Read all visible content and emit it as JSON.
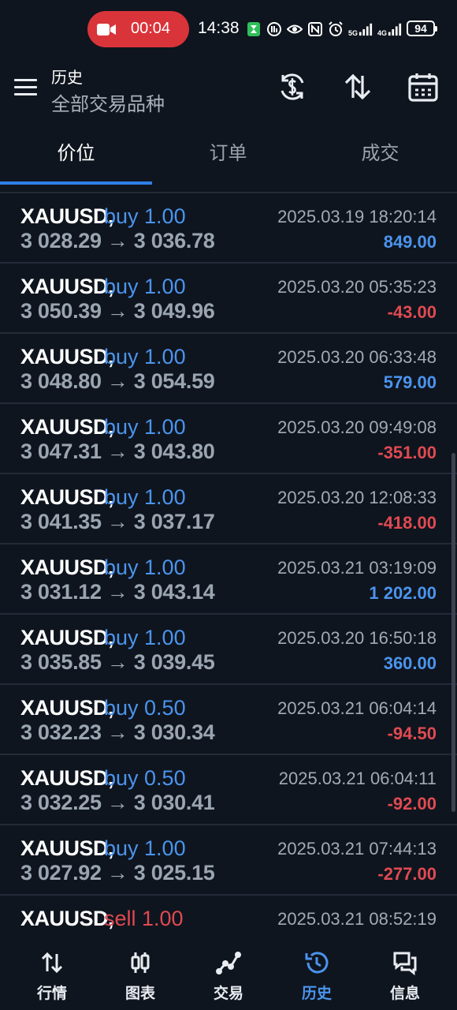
{
  "status_bar": {
    "recording_time": "00:04",
    "clock": "14:38",
    "net_5g": "5G",
    "net_4g": "4G",
    "battery": "94"
  },
  "header": {
    "title": "历史",
    "subtitle": "全部交易品种"
  },
  "tabs": [
    {
      "label": "价位",
      "active": true
    },
    {
      "label": "订单",
      "active": false
    },
    {
      "label": "成交",
      "active": false
    }
  ],
  "deals": [
    {
      "symbol": "XAUUSD,",
      "side": "buy 1.00",
      "type": "buy",
      "prices": "3 028.29 → 3 036.78",
      "time": "2025.03.19 18:20:14",
      "profit": "849.00",
      "sign": "pos"
    },
    {
      "symbol": "XAUUSD,",
      "side": "buy 1.00",
      "type": "buy",
      "prices": "3 050.39 → 3 049.96",
      "time": "2025.03.20 05:35:23",
      "profit": "-43.00",
      "sign": "neg"
    },
    {
      "symbol": "XAUUSD,",
      "side": "buy 1.00",
      "type": "buy",
      "prices": "3 048.80 → 3 054.59",
      "time": "2025.03.20 06:33:48",
      "profit": "579.00",
      "sign": "pos"
    },
    {
      "symbol": "XAUUSD,",
      "side": "buy 1.00",
      "type": "buy",
      "prices": "3 047.31 → 3 043.80",
      "time": "2025.03.20 09:49:08",
      "profit": "-351.00",
      "sign": "neg"
    },
    {
      "symbol": "XAUUSD,",
      "side": "buy 1.00",
      "type": "buy",
      "prices": "3 041.35 → 3 037.17",
      "time": "2025.03.20 12:08:33",
      "profit": "-418.00",
      "sign": "neg"
    },
    {
      "symbol": "XAUUSD,",
      "side": "buy 1.00",
      "type": "buy",
      "prices": "3 031.12 → 3 043.14",
      "time": "2025.03.21 03:19:09",
      "profit": "1 202.00",
      "sign": "pos"
    },
    {
      "symbol": "XAUUSD,",
      "side": "buy 1.00",
      "type": "buy",
      "prices": "3 035.85 → 3 039.45",
      "time": "2025.03.20 16:50:18",
      "profit": "360.00",
      "sign": "pos"
    },
    {
      "symbol": "XAUUSD,",
      "side": "buy 0.50",
      "type": "buy",
      "prices": "3 032.23 → 3 030.34",
      "time": "2025.03.21 06:04:14",
      "profit": "-94.50",
      "sign": "neg"
    },
    {
      "symbol": "XAUUSD,",
      "side": "buy 0.50",
      "type": "buy",
      "prices": "3 032.25 → 3 030.41",
      "time": "2025.03.21 06:04:11",
      "profit": "-92.00",
      "sign": "neg"
    },
    {
      "symbol": "XAUUSD,",
      "side": "buy 1.00",
      "type": "buy",
      "prices": "3 027.92 → 3 025.15",
      "time": "2025.03.21 07:44:13",
      "profit": "-277.00",
      "sign": "neg"
    },
    {
      "symbol": "XAUUSD,",
      "side": "sell 1.00",
      "type": "sell",
      "prices": "",
      "time": "2025.03.21 08:52:19",
      "profit": "",
      "sign": "neg"
    }
  ],
  "bottom_nav": [
    {
      "label": "行情",
      "icon": "quotes-icon",
      "active": false
    },
    {
      "label": "图表",
      "icon": "chart-icon",
      "active": false
    },
    {
      "label": "交易",
      "icon": "trade-icon",
      "active": false
    },
    {
      "label": "历史",
      "icon": "history-icon",
      "active": true
    },
    {
      "label": "信息",
      "icon": "messages-icon",
      "active": false
    }
  ],
  "colors": {
    "background": "#0f151e",
    "accent_blue": "#4b94ee",
    "loss_red": "#e04a52",
    "recording_red": "#d9343a"
  }
}
